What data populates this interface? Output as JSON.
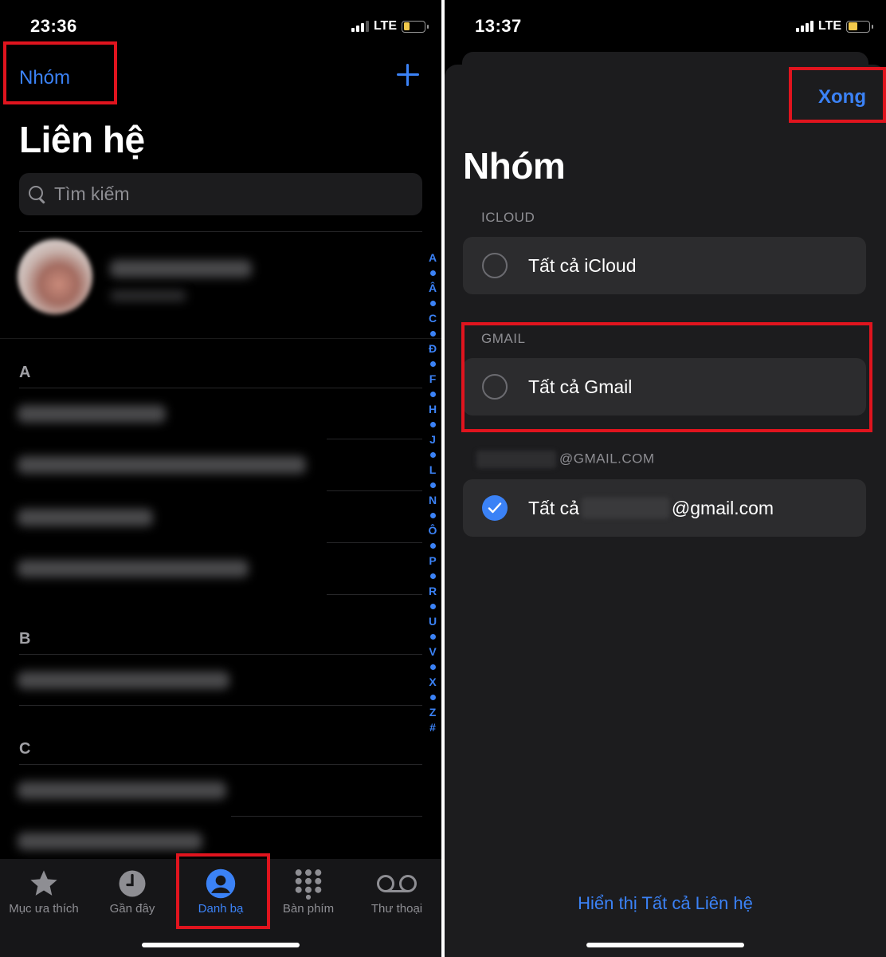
{
  "left": {
    "status": {
      "time": "23:36",
      "network": "LTE"
    },
    "nav": {
      "groups_label": "Nhóm"
    },
    "title": "Liên hệ",
    "search": {
      "placeholder": "Tìm kiếm"
    },
    "sections": [
      "A",
      "B",
      "C"
    ],
    "index_letters": [
      "A",
      "Â",
      "C",
      "Đ",
      "F",
      "H",
      "J",
      "L",
      "N",
      "Ô",
      "P",
      "R",
      "U",
      "V",
      "X",
      "Z",
      "#"
    ],
    "tabs": [
      {
        "label": "Mục ưa thích",
        "icon": "star-icon"
      },
      {
        "label": "Gần đây",
        "icon": "clock-icon"
      },
      {
        "label": "Danh bạ",
        "icon": "person-circle-icon"
      },
      {
        "label": "Bàn phím",
        "icon": "keypad-icon"
      },
      {
        "label": "Thư thoại",
        "icon": "voicemail-icon"
      }
    ]
  },
  "right": {
    "status": {
      "time": "13:37",
      "network": "LTE"
    },
    "done_label": "Xong",
    "title": "Nhóm",
    "groups": [
      {
        "header": "ICLOUD",
        "label": "Tất cả iCloud",
        "checked": false
      },
      {
        "header": "GMAIL",
        "label": "Tất cả Gmail",
        "checked": false
      },
      {
        "header_suffix": "@GMAIL.COM",
        "label_prefix": "Tất cả",
        "label_suffix": "@gmail.com",
        "checked": true
      }
    ],
    "show_all": "Hiển thị Tất cả Liên hệ"
  },
  "colors": {
    "accent": "#3b82f6",
    "highlight": "#e0141e",
    "background": "#000000"
  }
}
